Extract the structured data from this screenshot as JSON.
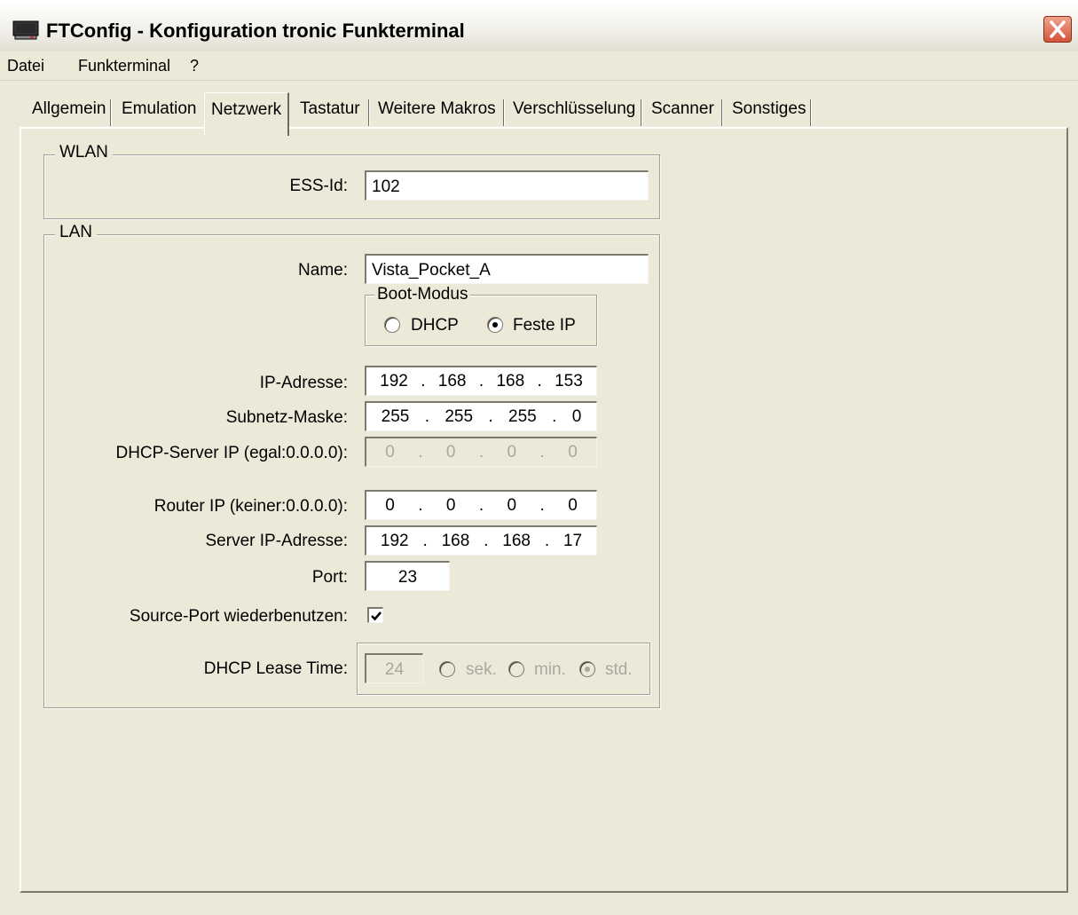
{
  "window": {
    "title": "FTConfig - Konfiguration tronic Funkterminal"
  },
  "menu": {
    "items": [
      "Datei",
      "Funkterminal",
      "?"
    ]
  },
  "tabs": [
    "Allgemein",
    "Emulation",
    "Netzwerk",
    "Tastatur",
    "Weitere Makros",
    "Verschlüsselung",
    "Scanner",
    "Sonstiges"
  ],
  "active_tab": "Netzwerk",
  "wlan": {
    "group_label": "WLAN",
    "ess_label": "ESS-Id:",
    "ess_value": "102"
  },
  "lan": {
    "group_label": "LAN",
    "name_label": "Name:",
    "name_value": "Vista_Pocket_A",
    "boot_group_label": "Boot-Modus",
    "boot_dhcp_label": "DHCP",
    "boot_fixed_label": "Feste IP",
    "boot_selected": "Feste IP",
    "ip_label": "IP-Adresse:",
    "ip": [
      "192",
      "168",
      "168",
      "153"
    ],
    "subnet_label": "Subnetz-Maske:",
    "subnet": [
      "255",
      "255",
      "255",
      "0"
    ],
    "dhcp_server_label": "DHCP-Server IP (egal:0.0.0.0):",
    "dhcp_server": [
      "0",
      "0",
      "0",
      "0"
    ],
    "router_label": "Router IP (keiner:0.0.0.0):",
    "router": [
      "0",
      "0",
      "0",
      "0"
    ],
    "server_label": "Server IP-Adresse:",
    "server": [
      "192",
      "168",
      "168",
      "17"
    ],
    "port_label": "Port:",
    "port_value": "23",
    "reuse_label": "Source-Port wiederbenutzen:",
    "reuse_checked": true,
    "lease_label": "DHCP Lease Time:",
    "lease_value": "24",
    "lease_units": [
      "sek.",
      "min.",
      "std."
    ],
    "lease_selected": "std."
  }
}
